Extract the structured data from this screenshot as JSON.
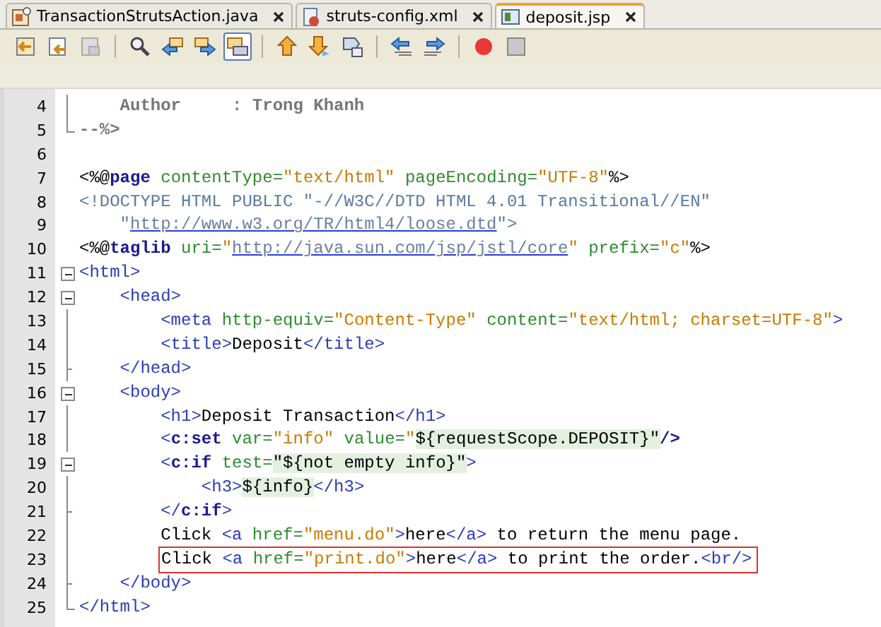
{
  "tabs": [
    {
      "label": "TransactionStrutsAction.java",
      "kind": "java",
      "selected": false
    },
    {
      "label": "struts-config.xml",
      "kind": "xml",
      "selected": false
    },
    {
      "label": "deposit.jsp",
      "kind": "jsp",
      "selected": true
    }
  ],
  "toolbar": [
    {
      "kind": "back",
      "selected": false
    },
    {
      "kind": "history",
      "selected": false
    },
    {
      "kind": "history-disabled",
      "selected": false
    },
    {
      "kind": "sep"
    },
    {
      "kind": "find",
      "selected": false
    },
    {
      "kind": "prev",
      "selected": false
    },
    {
      "kind": "next",
      "selected": false
    },
    {
      "kind": "toggle",
      "selected": true
    },
    {
      "kind": "sep"
    },
    {
      "kind": "up",
      "selected": false
    },
    {
      "kind": "down",
      "selected": false
    },
    {
      "kind": "shape",
      "selected": false
    },
    {
      "kind": "sep"
    },
    {
      "kind": "shift-left",
      "selected": false
    },
    {
      "kind": "shift-right",
      "selected": false
    },
    {
      "kind": "sep"
    },
    {
      "kind": "record",
      "selected": false
    },
    {
      "kind": "stop",
      "selected": false
    }
  ],
  "lines": [
    {
      "number": "4",
      "kind": "line",
      "boxed": false,
      "tokens": [
        {
          "kind": "comment",
          "text": "    Author     : Trong Khanh"
        }
      ]
    },
    {
      "number": "5",
      "kind": "end",
      "boxed": false,
      "tokens": [
        {
          "kind": "comment",
          "text": "--%>"
        }
      ]
    },
    {
      "number": "6",
      "kind": "none",
      "boxed": false
    },
    {
      "number": "7",
      "kind": "none",
      "boxed": false,
      "tokens": [
        {
          "kind": "plain",
          "text": "<%@"
        },
        {
          "kind": "keyword",
          "text": "page"
        },
        {
          "kind": "attr",
          "text": " contentType="
        },
        {
          "kind": "value",
          "text": "\"text/html\""
        },
        {
          "kind": "attr",
          "text": " pageEncoding="
        },
        {
          "kind": "value",
          "text": "\"UTF-8\""
        },
        {
          "kind": "plain",
          "text": "%>"
        }
      ]
    },
    {
      "number": "8",
      "kind": "none",
      "boxed": false,
      "tokens": [
        {
          "kind": "doctype",
          "text": "<!DOCTYPE HTML PUBLIC \"-//W3C//DTD HTML 4.01 Transitional//EN\""
        }
      ]
    },
    {
      "number": "9",
      "kind": "none",
      "boxed": false,
      "tokens": [
        {
          "kind": "doctype",
          "text": "    \""
        },
        {
          "kind": "url",
          "text": "http://www.w3.org/TR/html4/loose.dtd"
        },
        {
          "kind": "doctype",
          "text": "\">"
        }
      ]
    },
    {
      "number": "10",
      "kind": "none",
      "boxed": false,
      "tokens": [
        {
          "kind": "plain",
          "text": "<%@"
        },
        {
          "kind": "keyword",
          "text": "taglib"
        },
        {
          "kind": "attr",
          "text": " uri="
        },
        {
          "kind": "value",
          "text": "\""
        },
        {
          "kind": "url",
          "text": "http://java.sun.com/jsp/jstl/core"
        },
        {
          "kind": "value",
          "text": "\""
        },
        {
          "kind": "attr",
          "text": " prefix="
        },
        {
          "kind": "value",
          "text": "\"c\""
        },
        {
          "kind": "plain",
          "text": "%>"
        }
      ]
    },
    {
      "number": "11",
      "kind": "open",
      "boxed": false,
      "tokens": [
        {
          "kind": "tag",
          "text": "<html>"
        }
      ]
    },
    {
      "number": "12",
      "kind": "open",
      "boxed": false,
      "tokens": [
        {
          "kind": "tag",
          "text": "    <head>"
        }
      ]
    },
    {
      "number": "13",
      "kind": "line",
      "boxed": false,
      "tokens": [
        {
          "kind": "tag",
          "text": "        <meta"
        },
        {
          "kind": "attr",
          "text": " http-equiv="
        },
        {
          "kind": "value",
          "text": "\"Content-Type\""
        },
        {
          "kind": "attr",
          "text": " content="
        },
        {
          "kind": "value",
          "text": "\"text/html; charset=UTF-8\""
        },
        {
          "kind": "tag",
          "text": ">"
        }
      ]
    },
    {
      "number": "14",
      "kind": "line",
      "boxed": false,
      "tokens": [
        {
          "kind": "tag",
          "text": "        <title>"
        },
        {
          "kind": "plain",
          "text": "Deposit"
        },
        {
          "kind": "tag",
          "text": "</title>"
        }
      ]
    },
    {
      "number": "15",
      "kind": "mid",
      "boxed": false,
      "tokens": [
        {
          "kind": "tag",
          "text": "    </head>"
        }
      ]
    },
    {
      "number": "16",
      "kind": "open",
      "boxed": false,
      "tokens": [
        {
          "kind": "tag",
          "text": "    <body>"
        }
      ]
    },
    {
      "number": "17",
      "kind": "line",
      "boxed": false,
      "tokens": [
        {
          "kind": "tag",
          "text": "        <h1>"
        },
        {
          "kind": "plain",
          "text": "Deposit Transaction"
        },
        {
          "kind": "tag",
          "text": "</h1>"
        }
      ]
    },
    {
      "number": "18",
      "kind": "line",
      "boxed": false,
      "tokens": [
        {
          "kind": "tag",
          "text": "        <"
        },
        {
          "kind": "keyword",
          "text": "c:set"
        },
        {
          "kind": "attr",
          "text": " var="
        },
        {
          "kind": "value",
          "text": "\"info\""
        },
        {
          "kind": "attr",
          "text": " value="
        },
        {
          "kind": "value",
          "text": "\""
        },
        {
          "kind": "el",
          "text": "${requestScope.DEPOSIT}\""
        },
        {
          "kind": "keyword",
          "text": "/>"
        }
      ]
    },
    {
      "number": "19",
      "kind": "open",
      "boxed": false,
      "tokens": [
        {
          "kind": "tag",
          "text": "        <"
        },
        {
          "kind": "keyword",
          "text": "c:if"
        },
        {
          "kind": "attr",
          "text": " test="
        },
        {
          "kind": "el",
          "text": "\"${not empty info}\""
        },
        {
          "kind": "tag",
          "text": ">"
        }
      ]
    },
    {
      "number": "20",
      "kind": "line",
      "boxed": false,
      "tokens": [
        {
          "kind": "tag",
          "text": "            <h3>"
        },
        {
          "kind": "el",
          "text": "${info}"
        },
        {
          "kind": "tag",
          "text": "</h3>"
        }
      ]
    },
    {
      "number": "21",
      "kind": "mid",
      "boxed": false,
      "tokens": [
        {
          "kind": "tag",
          "text": "        </"
        },
        {
          "kind": "keyword",
          "text": "c:if"
        },
        {
          "kind": "tag",
          "text": ">"
        }
      ]
    },
    {
      "number": "22",
      "kind": "line",
      "boxed": false,
      "tokens": [
        {
          "kind": "plain",
          "text": "        Click "
        },
        {
          "kind": "tag",
          "text": "<a"
        },
        {
          "kind": "attr",
          "text": " href="
        },
        {
          "kind": "value",
          "text": "\"menu.do\""
        },
        {
          "kind": "tag",
          "text": ">"
        },
        {
          "kind": "plain",
          "text": "here"
        },
        {
          "kind": "tag",
          "text": "</a>"
        },
        {
          "kind": "plain",
          "text": " to return the menu page."
        }
      ]
    },
    {
      "number": "23",
      "kind": "line",
      "boxed": true,
      "tokens": [
        {
          "kind": "plain",
          "text": "Click "
        },
        {
          "kind": "tag",
          "text": "<a"
        },
        {
          "kind": "attr",
          "text": " href="
        },
        {
          "kind": "value",
          "text": "\"print.do\""
        },
        {
          "kind": "tag",
          "text": ">"
        },
        {
          "kind": "plain",
          "text": "here"
        },
        {
          "kind": "tag",
          "text": "</a>"
        },
        {
          "kind": "plain",
          "text": " to print the order."
        },
        {
          "kind": "tag",
          "text": "<br/>"
        }
      ]
    },
    {
      "number": "24",
      "kind": "mid",
      "boxed": false,
      "tokens": [
        {
          "kind": "tag",
          "text": "    </body>"
        }
      ]
    },
    {
      "number": "25",
      "kind": "end",
      "boxed": false,
      "tokens": [
        {
          "kind": "tag",
          "text": "</html>"
        }
      ]
    }
  ]
}
